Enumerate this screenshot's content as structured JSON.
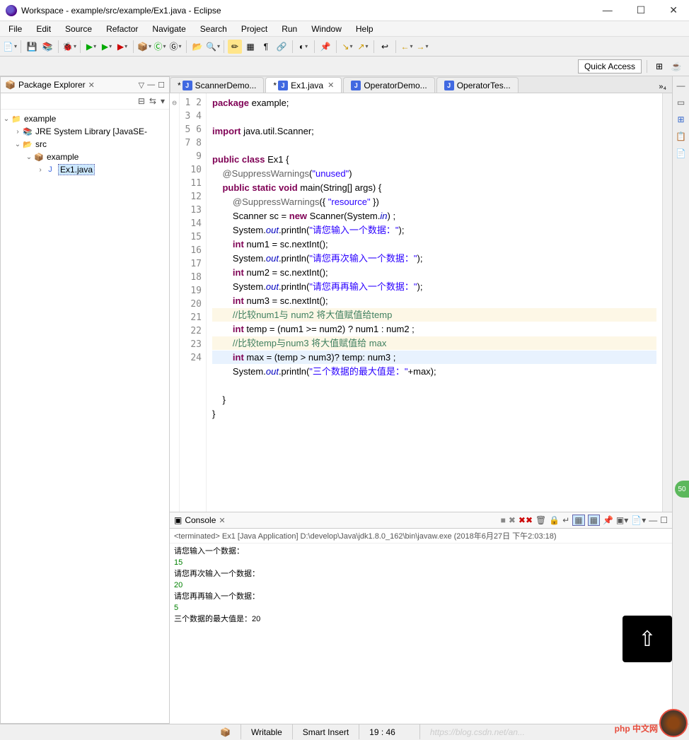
{
  "window": {
    "title": "Workspace - example/src/example/Ex1.java - Eclipse"
  },
  "menu": [
    "File",
    "Edit",
    "Source",
    "Refactor",
    "Navigate",
    "Search",
    "Project",
    "Run",
    "Window",
    "Help"
  ],
  "quick_access": "Quick Access",
  "package_explorer": {
    "title": "Package Explorer",
    "tree": {
      "project": "example",
      "jre": "JRE System Library [JavaSE-",
      "src": "src",
      "pkg": "example",
      "file": "Ex1.java"
    }
  },
  "editor_tabs": [
    {
      "label": "ScannerDemo...",
      "dirty": true,
      "active": false
    },
    {
      "label": "Ex1.java",
      "dirty": true,
      "active": true
    },
    {
      "label": "OperatorDemo...",
      "dirty": false,
      "active": false
    },
    {
      "label": "OperatorTes...",
      "dirty": false,
      "active": false
    }
  ],
  "code": {
    "lines": [
      {
        "n": 1,
        "ann": "",
        "html": "<span class='kw'>package</span> example;"
      },
      {
        "n": 2,
        "ann": "",
        "html": ""
      },
      {
        "n": 3,
        "ann": "",
        "html": "<span class='kw'>import</span> java.util.Scanner;"
      },
      {
        "n": 4,
        "ann": "",
        "html": ""
      },
      {
        "n": 5,
        "ann": "",
        "html": "<span class='kw'>public</span> <span class='kw'>class</span> Ex1 {"
      },
      {
        "n": 6,
        "ann": "⊖",
        "html": "    <span class='ann'>@SuppressWarnings</span>(<span class='str'>\"unused\"</span>)"
      },
      {
        "n": 7,
        "ann": "",
        "html": "    <span class='kw'>public</span> <span class='kw'>static</span> <span class='kw'>void</span> main(String[] args) {"
      },
      {
        "n": 8,
        "ann": "",
        "html": "        <span class='ann'>@SuppressWarnings</span>({ <span class='str'>\"resource\"</span> })"
      },
      {
        "n": 9,
        "ann": "",
        "html": "        Scanner sc = <span class='kw'>new</span> Scanner(System.<span class='fld'>in</span>) ;"
      },
      {
        "n": 10,
        "ann": "",
        "html": "        System.<span class='fld'>out</span>.println(<span class='str'>\"请您输入一个数据：\"</span>);"
      },
      {
        "n": 11,
        "ann": "",
        "html": "        <span class='kw'>int</span> num1 = sc.nextInt();"
      },
      {
        "n": 12,
        "ann": "",
        "html": "        System.<span class='fld'>out</span>.println(<span class='str'>\"请您再次输入一个数据：\"</span>);"
      },
      {
        "n": 13,
        "ann": "",
        "html": "        <span class='kw'>int</span> num2 = sc.nextInt();"
      },
      {
        "n": 14,
        "ann": "",
        "html": "        System.<span class='fld'>out</span>.println(<span class='str'>\"请您再再输入一个数据：\"</span>);"
      },
      {
        "n": 15,
        "ann": "",
        "html": "        <span class='kw'>int</span> num3 = sc.nextInt();"
      },
      {
        "n": 16,
        "ann": "",
        "cls": "warn-line",
        "html": "        <span class='com'>//比较num1与 num2 将大值赋值给temp</span>"
      },
      {
        "n": 17,
        "ann": "",
        "html": "        <span class='kw'>int</span> temp = (num1 &gt;= num2) ? num1 : num2 ;"
      },
      {
        "n": 18,
        "ann": "",
        "cls": "warn-line",
        "html": "        <span class='com'>//比较temp与num3 将大值赋值给 max</span>"
      },
      {
        "n": 19,
        "ann": "",
        "cls": "hl-line",
        "html": "        <span class='kw'>int</span> max = (temp &gt; num3)? temp: num3 ;"
      },
      {
        "n": 20,
        "ann": "",
        "html": "        System.<span class='fld'>out</span>.println(<span class='str'>\"三个数据的最大值是：\"</span>+max);"
      },
      {
        "n": 21,
        "ann": "",
        "html": ""
      },
      {
        "n": 22,
        "ann": "",
        "html": "    }"
      },
      {
        "n": 23,
        "ann": "",
        "html": "}"
      },
      {
        "n": 24,
        "ann": "",
        "html": ""
      }
    ]
  },
  "console": {
    "title": "Console",
    "header": "<terminated> Ex1 [Java Application] D:\\develop\\Java\\jdk1.8.0_162\\bin\\javaw.exe (2018年6月27日 下午2:03:18)",
    "lines": [
      {
        "t": "请您输入一个数据：",
        "cls": ""
      },
      {
        "t": "15",
        "cls": "in"
      },
      {
        "t": "请您再次输入一个数据：",
        "cls": ""
      },
      {
        "t": "20",
        "cls": "in"
      },
      {
        "t": "请您再再输入一个数据：",
        "cls": ""
      },
      {
        "t": "5",
        "cls": "in"
      },
      {
        "t": "三个数据的最大值是：20",
        "cls": ""
      }
    ]
  },
  "status": {
    "writable": "Writable",
    "insert": "Smart Insert",
    "pos": "19 : 46",
    "watermark": "https://blog.csdn.net/an..."
  },
  "badge50": "50",
  "php_badge": "php 中文网"
}
